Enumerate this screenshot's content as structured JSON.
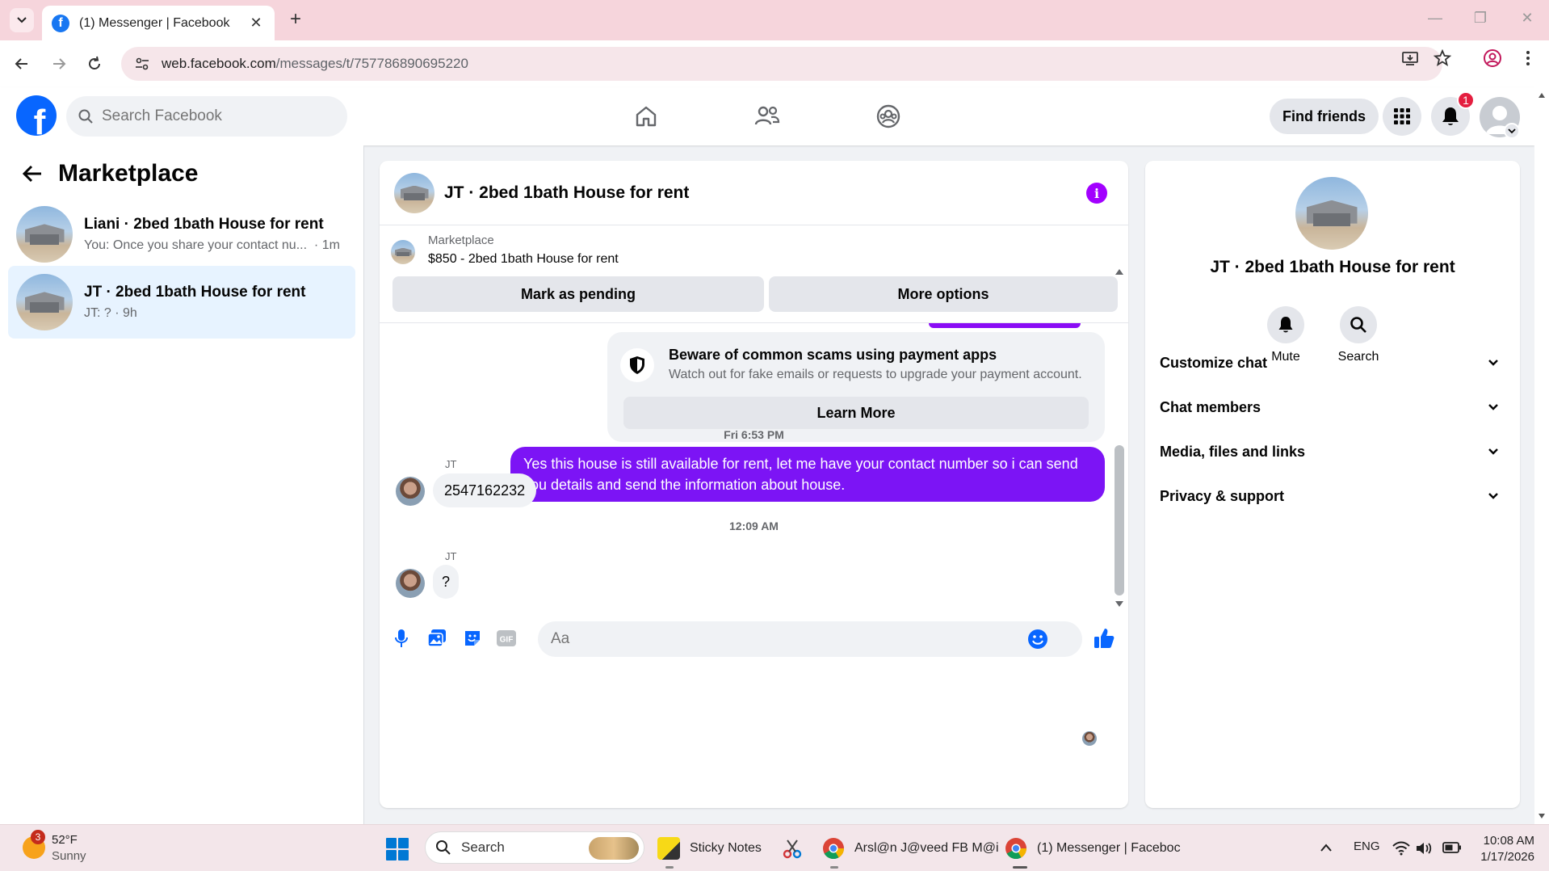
{
  "browser": {
    "tab_title": "(1) Messenger | Facebook",
    "url_host": "web.facebook.com",
    "url_path": "/messages/t/757786890695220"
  },
  "fb_header": {
    "search_placeholder": "Search Facebook",
    "find_friends_label": "Find friends",
    "notification_count": "1"
  },
  "sidebar": {
    "title": "Marketplace",
    "conversations": [
      {
        "name": "Liani · 2bed 1bath House for rent",
        "preview": "You: Once you share your contact nu...",
        "time": "1m",
        "active": false
      },
      {
        "name": "JT · 2bed 1bath House for rent",
        "preview": "JT: ?",
        "time": "9h",
        "active": true
      }
    ]
  },
  "chat": {
    "title": "JT · 2bed 1bath House for rent",
    "listing_kind": "Marketplace",
    "listing_price": "$850 - 2bed 1bath House for rent",
    "mark_pending_label": "Mark as pending",
    "more_options_label": "More options",
    "scam_title": "Beware of common scams using payment apps",
    "scam_desc": "Watch out for fake emails or requests to upgrade your payment account.",
    "learn_more_label": "Learn More",
    "outgoing_message": "Yes this house is still available for rent, let me have your contact number so i can send you details and send the information about house.",
    "timestamp_1": "Fri 6:53 PM",
    "sender_1": "JT",
    "incoming_1": "2547162232",
    "timestamp_2": "12:09 AM",
    "sender_2": "JT",
    "incoming_2": "?",
    "composer_placeholder": "Aa",
    "accent_color": "#7c14f5"
  },
  "info_panel": {
    "name": "JT · 2bed 1bath House for rent",
    "mute_label": "Mute",
    "search_label": "Search",
    "rows": [
      "Customize chat",
      "Chat members",
      "Media, files and links",
      "Privacy & support"
    ]
  },
  "taskbar": {
    "weather_badge": "3",
    "temperature": "52°F",
    "condition": "Sunny",
    "search_label": "Search",
    "apps": [
      "Sticky Notes",
      "Arsl@n J@veed FB M@i",
      "(1) Messenger | Faceboc"
    ],
    "language": "ENG",
    "time": "10:08 AM",
    "date": "1/17/2026"
  }
}
